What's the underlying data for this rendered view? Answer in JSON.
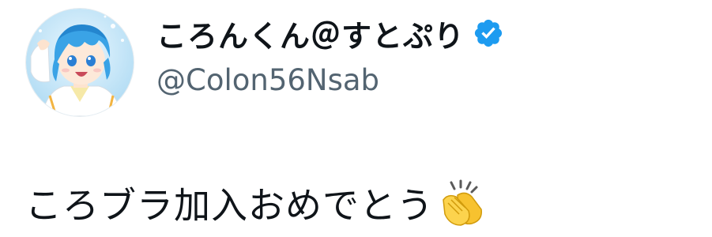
{
  "tweet": {
    "author": {
      "display_name": "ころんくん＠すとぷり",
      "handle": "@Colon56Nsab",
      "verified_icon": "verified-badge-icon",
      "avatar_icon": "avatar-illustration"
    },
    "text": "ころブラ加入おめでとう",
    "emoji_icon": "clapping-hands-icon"
  },
  "colors": {
    "verified_blue": "#1d9bf0",
    "handle_gray": "#536471",
    "text_black": "#0f1419",
    "avatar_bg": "#bfe3f6",
    "avatar_hair": "#3aa3e6"
  }
}
